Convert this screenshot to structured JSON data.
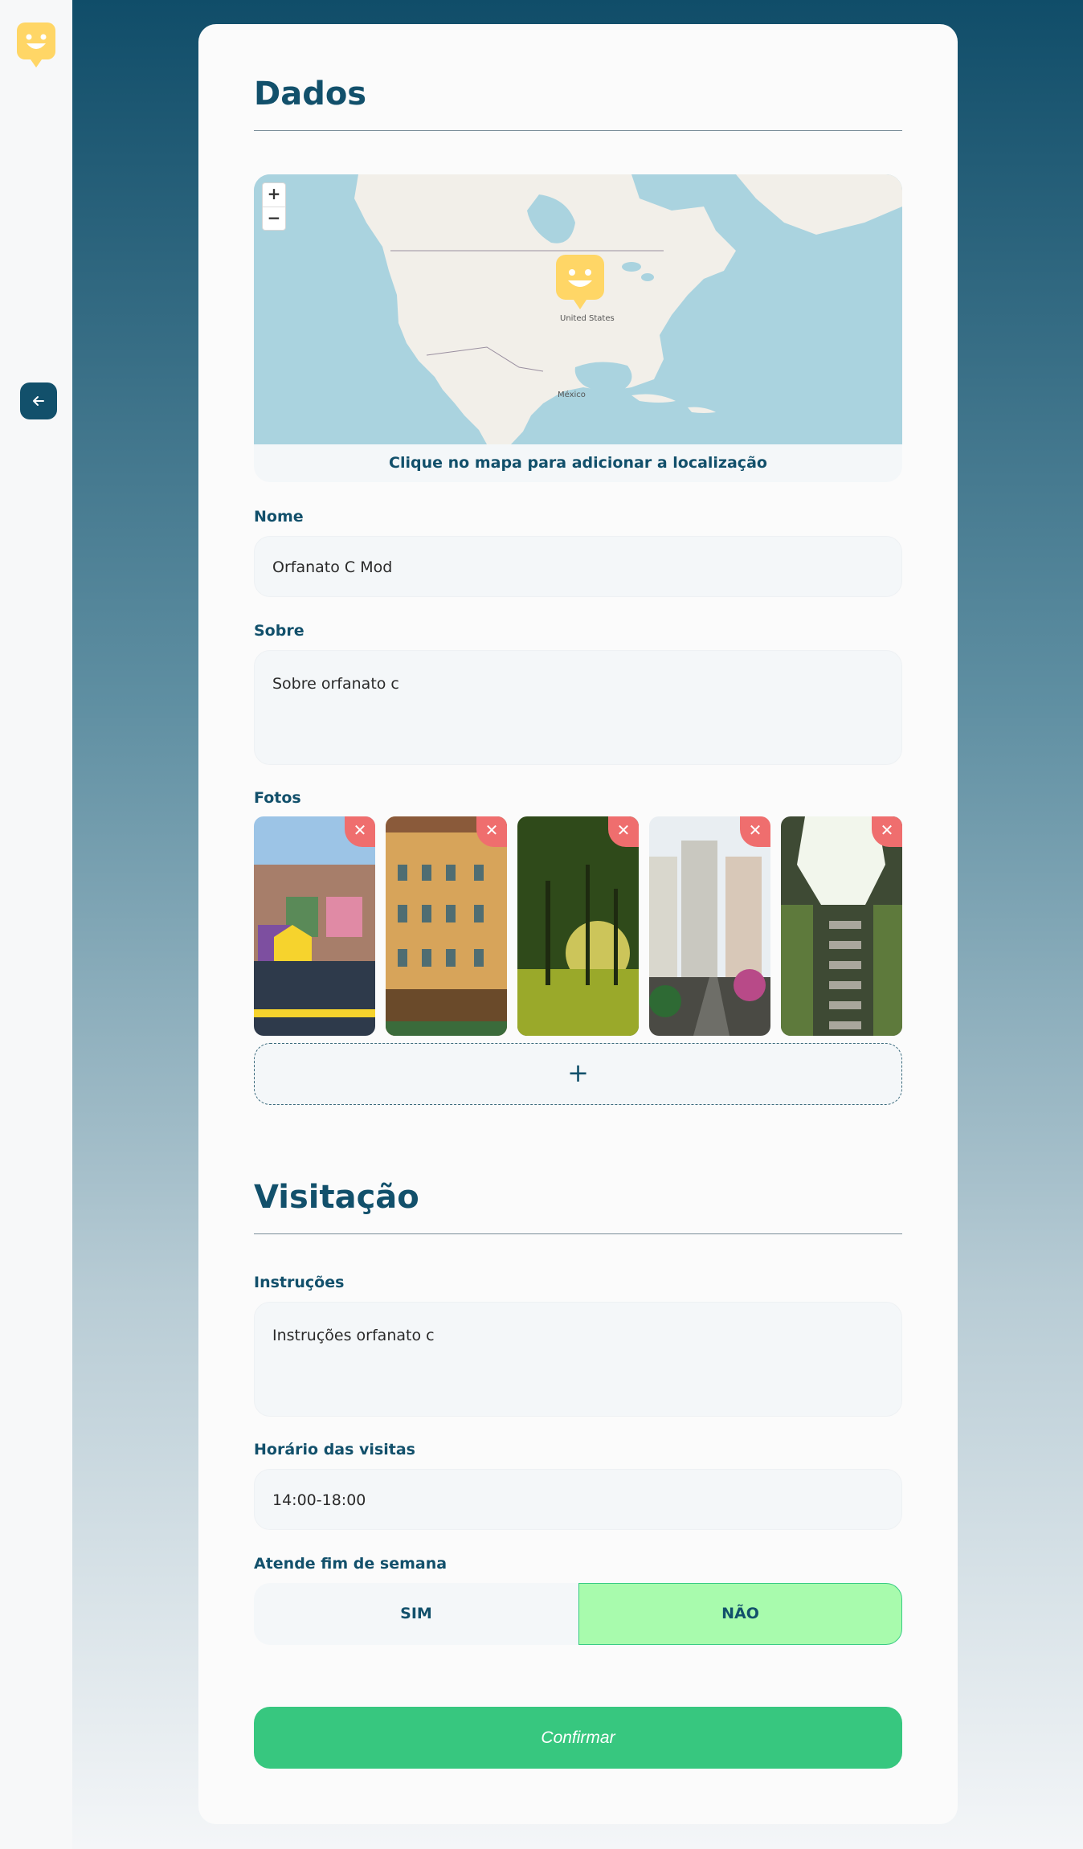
{
  "brand": {
    "logo_color": "#ffd666",
    "primary_color": "#12506b",
    "confirm_color": "#37c77f",
    "remove_color": "#ef6e6e"
  },
  "sidebar": {
    "logo_icon": "smiley-pin-logo",
    "back_icon": "arrow-left-icon"
  },
  "dados": {
    "title": "Dados",
    "map": {
      "zoom_in": "+",
      "zoom_out": "−",
      "label_us": "United States",
      "label_mexico": "México",
      "caption": "Clique no mapa para adicionar a localização"
    },
    "nome": {
      "label": "Nome",
      "value": "Orfanato C Mod"
    },
    "sobre": {
      "label": "Sobre",
      "value": "Sobre orfanato c"
    },
    "fotos": {
      "label": "Fotos",
      "remove_symbol": "✕",
      "add_symbol": "+",
      "items": [
        "photo-graffiti-street",
        "photo-yellow-building",
        "photo-forest-sunlight",
        "photo-city-street",
        "photo-green-tower"
      ]
    }
  },
  "visitacao": {
    "title": "Visitação",
    "instrucoes": {
      "label": "Instruções",
      "value": "Instruções orfanato c"
    },
    "horario": {
      "label": "Horário das visitas",
      "value": "14:00-18:00"
    },
    "fim_de_semana": {
      "label": "Atende fim de semana",
      "yes": "SIM",
      "no": "NÃO",
      "selected": "NÃO"
    }
  },
  "confirm_label": "Confirmar"
}
